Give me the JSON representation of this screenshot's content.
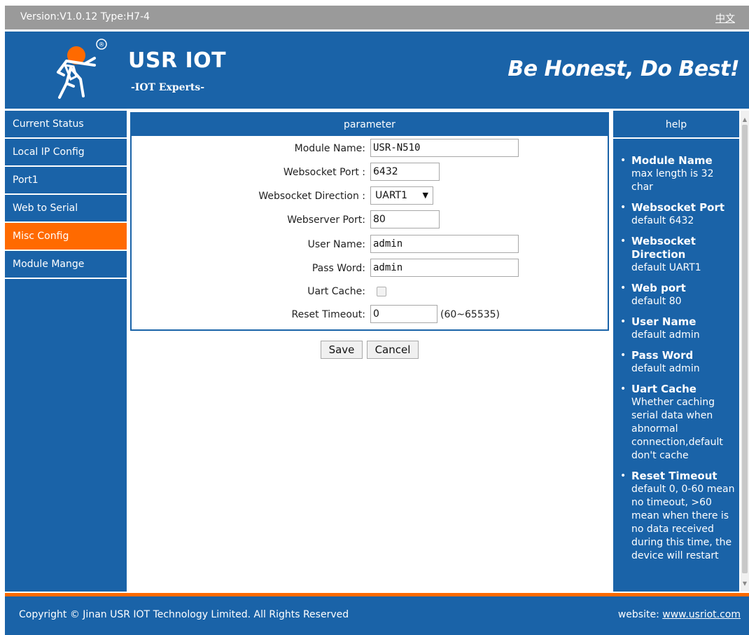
{
  "topbar": {
    "version_text": "Version:V1.0.12 Type:H7-4",
    "language_link": "中文"
  },
  "header": {
    "brand_name": "USR IOT",
    "brand_tagline": "-IOT Experts-",
    "slogan": "Be Honest, Do Best!",
    "logo_icon": "usr-running-man-logo",
    "registered_mark": "®"
  },
  "sidebar": {
    "items": [
      {
        "label": "Current Status",
        "active": false
      },
      {
        "label": "Local IP Config",
        "active": false
      },
      {
        "label": "Port1",
        "active": false
      },
      {
        "label": "Web to Serial",
        "active": false
      },
      {
        "label": "Misc Config",
        "active": true
      },
      {
        "label": "Module Mange",
        "active": false
      }
    ]
  },
  "main": {
    "title": "parameter",
    "fields": {
      "module_name": {
        "label": "Module Name:",
        "value": "USR-N510"
      },
      "websocket_port": {
        "label": "Websocket Port :",
        "value": "6432"
      },
      "websocket_direction": {
        "label": "Websocket Direction :",
        "value": "UART1"
      },
      "webserver_port": {
        "label": "Webserver Port:",
        "value": "80"
      },
      "user_name": {
        "label": "User Name:",
        "value": "admin"
      },
      "pass_word": {
        "label": "Pass Word:",
        "value": "admin"
      },
      "uart_cache": {
        "label": "Uart Cache:",
        "checked": false
      },
      "reset_timeout": {
        "label": "Reset Timeout:",
        "value": "0",
        "range_hint": "(60~65535)"
      }
    },
    "save_label": "Save",
    "cancel_label": "Cancel"
  },
  "help": {
    "title": "help",
    "items": [
      {
        "title": "Module Name",
        "text": "max length is 32 char"
      },
      {
        "title": "Websocket Port",
        "text": "default 6432"
      },
      {
        "title": "Websocket Direction",
        "text": "default UART1"
      },
      {
        "title": "Web port",
        "text": "default 80"
      },
      {
        "title": "User Name",
        "text": "default admin"
      },
      {
        "title": "Pass Word",
        "text": "default admin"
      },
      {
        "title": "Uart Cache",
        "text": "Whether caching serial data when abnormal connection,default don't cache"
      },
      {
        "title": "Reset Timeout",
        "text": "default 0, 0-60 mean no timeout, >60 mean when there is no data received during this time, the device will restart"
      }
    ]
  },
  "footer": {
    "copyright": "Copyright © Jinan USR IOT Technology Limited. All Rights Reserved",
    "website_label": "website:",
    "website_link": "www.usriot.com"
  },
  "colors": {
    "primary_blue": "#1a63a8",
    "accent_orange": "#ff6a00",
    "topbar_gray": "#9a9a9a"
  }
}
